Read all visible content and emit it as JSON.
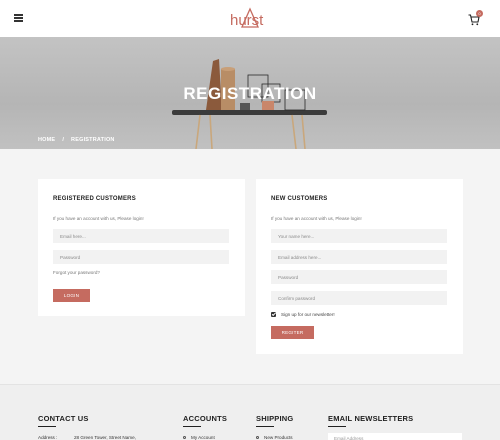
{
  "header": {
    "logo_text": "hurst",
    "cart_count": "0"
  },
  "hero": {
    "title": "REGISTRATION",
    "breadcrumb": {
      "home": "HOME",
      "separator": "/",
      "current": "REGISTRATION"
    }
  },
  "login": {
    "title": "REGISTERED CUSTOMERS",
    "hint": "If you have an account with us, Please login!",
    "email_placeholder": "Email here...",
    "password_placeholder": "Password",
    "forgot_label": "Forgot your password?",
    "button_label": "LOGIN"
  },
  "register": {
    "title": "NEW CUSTOMERS",
    "hint": "If you have an account with us, Please login!",
    "name_placeholder": "Your name here...",
    "email_placeholder": "Email address here...",
    "password_placeholder": "Password",
    "confirm_placeholder": "Confirm password",
    "newsletter_label": "Sign up for our newsletter!",
    "newsletter_checked": true,
    "button_label": "REGITER"
  },
  "footer": {
    "contact": {
      "title": "CONTACT US",
      "address_label": "Address :",
      "address_value": "28 Green Tower, Street Name,"
    },
    "accounts": {
      "title": "ACCOUNTS",
      "first_link": "My Account"
    },
    "shipping": {
      "title": "SHIPPING",
      "first_link": "New Products"
    },
    "newsletter": {
      "title": "EMAIL NEWSLETTERS",
      "email_placeholder": "Email Address"
    }
  },
  "colors": {
    "accent": "#c56b60",
    "background": "#f4f4f4",
    "card": "#ffffff"
  }
}
